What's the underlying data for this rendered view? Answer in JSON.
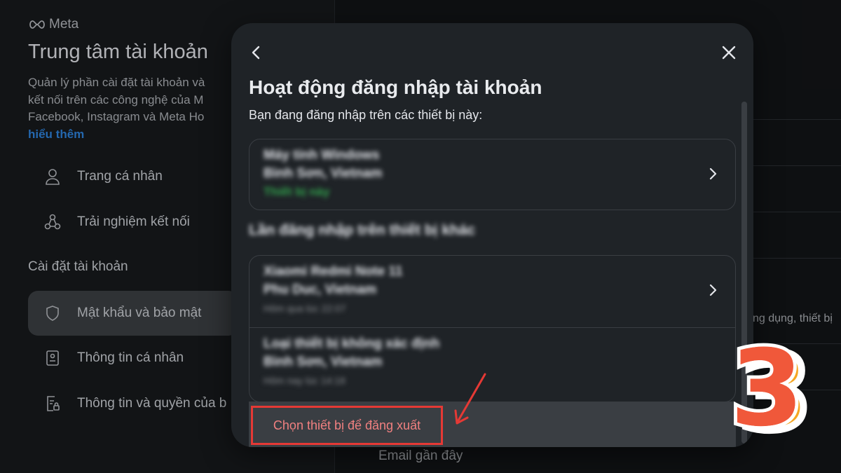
{
  "background": {
    "brand": "Meta",
    "title": "Trung tâm tài khoản",
    "description_lines": [
      "Quản lý phần cài đặt tài khoản và",
      "kết nối trên các công nghệ của M",
      "Facebook, Instagram và Meta Ho"
    ],
    "learn_more": "hiểu thêm",
    "nav": {
      "profile": "Trang cá nhân",
      "connected": "Trải nghiệm kết nối",
      "section_account": "Cài đặt tài khoản",
      "password_security": "Mật khẩu và bảo mật",
      "personal_info": "Thông tin cá nhân",
      "info_permissions": "Thông tin và quyền của b"
    },
    "right_partial_text": "ng dụng, thiết bị",
    "email_recent": "Email gần đây"
  },
  "modal": {
    "title": "Hoạt động đăng nhập tài khoản",
    "subtitle": "Bạn đang đăng nhập trên các thiết bị này:",
    "current_device": {
      "name": "Máy tính Windows",
      "location": "Bình Sơn, Vietnam",
      "status": "Thiết bị này"
    },
    "other_heading": "Lần đăng nhập trên thiết bị khác",
    "other_devices": [
      {
        "name": "Xiaomi Redmi Note 11",
        "location": "Phu Duc, Vietnam",
        "time": "Hôm qua lúc 22:07"
      },
      {
        "name": "Loại thiết bị không xác định",
        "location": "Bình Sơn, Vietnam",
        "time": "Hôm nay lúc 14:18"
      }
    ],
    "logout_link": "Chọn thiết bị để đăng xuất"
  },
  "annotation": {
    "step_number": "3",
    "highlight_color": "#e53935",
    "badge_color": "#f0583a",
    "badge_shadow_color": "#f5a623"
  }
}
